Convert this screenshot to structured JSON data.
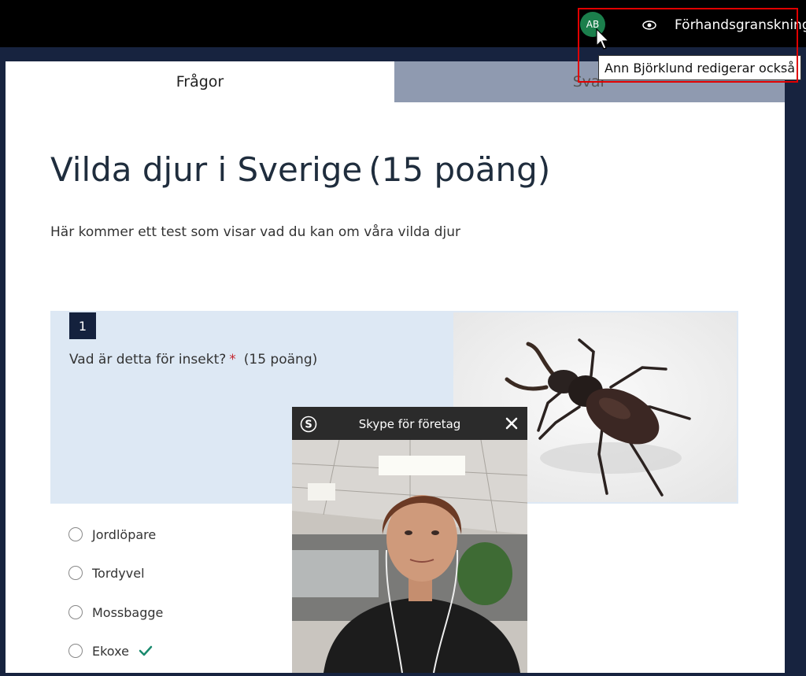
{
  "topbar": {
    "avatar_initials": "AB",
    "preview_label": "Förhandsgranskning",
    "tooltip": "Ann Björklund redigerar också"
  },
  "tabs": {
    "questions": "Frågor",
    "answers": "Svar"
  },
  "form": {
    "title": "Vilda djur i Sverige",
    "points": "(15 poäng)",
    "description": "Här kommer ett test som visar vad du kan om våra vilda djur"
  },
  "question": {
    "number": "1",
    "text": "Vad är detta för insekt?",
    "required_mark": "*",
    "points": "(15 poäng)",
    "image_icon": "stag-beetle-image",
    "options": [
      "Jordlöpare",
      "Tordyvel",
      "Mossbagge",
      "Ekoxe"
    ],
    "correct_index": 3
  },
  "skype": {
    "title": "Skype för företag",
    "close_icon": "close-icon",
    "video": "participant-video-feed"
  },
  "colors": {
    "accent_dark": "#14213d",
    "avatar": "#1b7f4c",
    "highlight": "#e00000",
    "correct": "#1a8a6e"
  }
}
